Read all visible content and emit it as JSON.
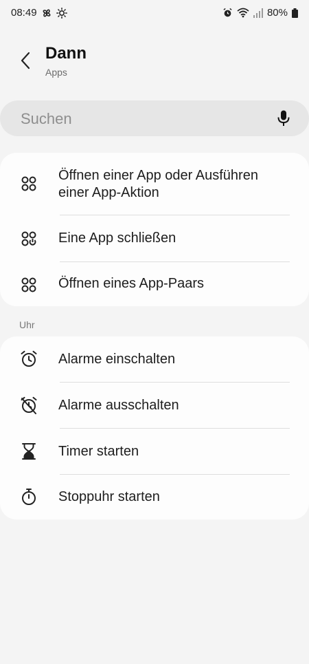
{
  "status": {
    "time": "08:49",
    "battery": "80%"
  },
  "header": {
    "title": "Dann",
    "subtitle": "Apps"
  },
  "search": {
    "placeholder": "Suchen"
  },
  "apps_section": {
    "items": [
      {
        "label_line1": "Öffnen einer App oder Ausführen",
        "label_line2": "einer App-Aktion",
        "icon": "apps-grid-icon"
      },
      {
        "label": "Eine App schließen",
        "icon": "apps-close-icon"
      },
      {
        "label": "Öffnen eines App-Paars",
        "icon": "app-pair-icon"
      }
    ]
  },
  "clock_section": {
    "title": "Uhr",
    "items": [
      {
        "label": "Alarme einschalten",
        "icon": "alarm-icon"
      },
      {
        "label": "Alarme ausschalten",
        "icon": "alarm-off-icon"
      },
      {
        "label": "Timer starten",
        "icon": "hourglass-icon"
      },
      {
        "label": "Stoppuhr starten",
        "icon": "stopwatch-icon"
      }
    ]
  }
}
